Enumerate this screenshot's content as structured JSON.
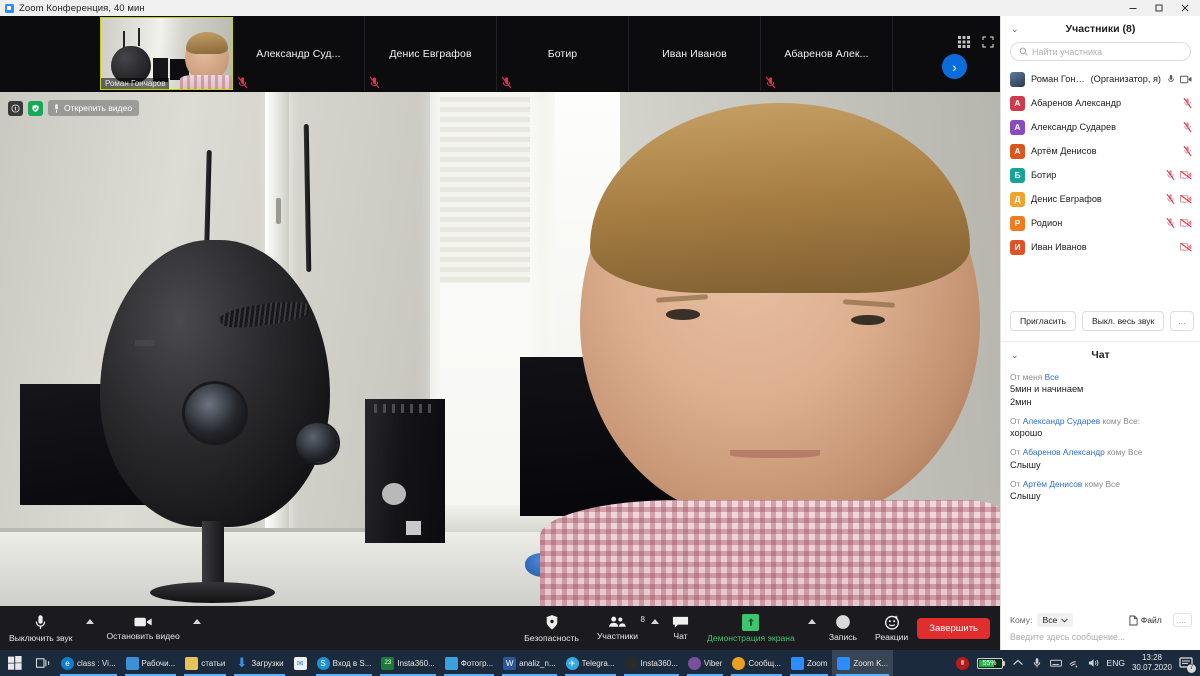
{
  "window": {
    "title": "Zoom Конференция, 40 мин",
    "app_icon": "zoom-icon",
    "minimize": "—",
    "maximize": "❐",
    "close": "✕"
  },
  "filmstrip": {
    "self": {
      "name": "Роман Гончаров"
    },
    "tiles": [
      {
        "name": "Александр  Суд...",
        "muted": true
      },
      {
        "name": "Денис Евграфов",
        "muted": true
      },
      {
        "name": "Ботир",
        "muted": true
      },
      {
        "name": "Иван Иванов",
        "muted": false
      },
      {
        "name": "Абаренов  Алек...",
        "muted": true
      }
    ],
    "next_arrow": "›",
    "grid_icon": "grid-view-icon",
    "fullscreen_icon": "fullscreen-icon"
  },
  "stage": {
    "pin_label": "Открепить видео",
    "speaker_name": "Роман Гончаров",
    "info_icon": "info-icon",
    "security_icon": "shield-icon",
    "mic_icon": "microphone-icon"
  },
  "toolbar": {
    "mute": "Выключить звук",
    "stop_video": "Остановить видео",
    "security": "Безопасность",
    "participants": "Участники",
    "participants_count": "8",
    "chat": "Чат",
    "share": "Демонстрация экрана",
    "record": "Запись",
    "reactions": "Реакции",
    "end": "Завершить"
  },
  "participants_panel": {
    "title": "Участники (8)",
    "collapse_icon": "chevron-down-icon",
    "search_placeholder": "Найти участника",
    "search_icon": "search-icon",
    "list": [
      {
        "name": "Роман Гончар...",
        "role": "(Организатор, я)",
        "initial": "",
        "color": "#3f5a78",
        "photo": true,
        "mic_muted": false,
        "cam_off": false
      },
      {
        "name": "Абаренов Александр",
        "role": "",
        "initial": "А",
        "color": "#cf3b4a",
        "photo": false,
        "mic_muted": true,
        "cam_off": false
      },
      {
        "name": "Александр Сударев",
        "role": "",
        "initial": "А",
        "color": "#8a4bbd",
        "photo": false,
        "mic_muted": true,
        "cam_off": false
      },
      {
        "name": "Артём Денисов",
        "role": "",
        "initial": "А",
        "color": "#d9571f",
        "photo": false,
        "mic_muted": true,
        "cam_off": false
      },
      {
        "name": "Ботир",
        "role": "",
        "initial": "Б",
        "color": "#17a398",
        "photo": false,
        "mic_muted": true,
        "cam_off": true
      },
      {
        "name": "Денис Евграфов",
        "role": "",
        "initial": "Д",
        "color": "#f0a32b",
        "photo": false,
        "mic_muted": true,
        "cam_off": true
      },
      {
        "name": "Родион",
        "role": "",
        "initial": "Р",
        "color": "#f07c1f",
        "photo": false,
        "mic_muted": true,
        "cam_off": true
      },
      {
        "name": "Иван Иванов",
        "role": "",
        "initial": "И",
        "color": "#e0522a",
        "photo": false,
        "mic_muted": false,
        "cam_off": true
      }
    ],
    "invite": "Пригласить",
    "mute_all": "Выкл. весь звук",
    "more": "..."
  },
  "chat_panel": {
    "title": "Чат",
    "collapse_icon": "chevron-down-icon",
    "messages": [
      {
        "prefix": "От меня",
        "who": "Все",
        "suffix": "",
        "lines": [
          "5мин и начинаем",
          "2мин"
        ]
      },
      {
        "prefix": "От",
        "who": "Александр Сударев",
        "suffix": "кому Все:",
        "lines": [
          "хорошо"
        ]
      },
      {
        "prefix": "От",
        "who": "Абаренов Александр",
        "suffix": "кому Все",
        "lines": [
          "Слышу"
        ]
      },
      {
        "prefix": "От",
        "who": "Артём Денисов",
        "suffix": "кому Все",
        "lines": [
          "Слышу"
        ]
      }
    ],
    "to_label": "Кому:",
    "to_value": "Все",
    "file_label": "Файл",
    "file_icon": "file-icon",
    "more": "...",
    "input_placeholder": "Введите здесь сообщение..."
  },
  "taskbar": {
    "start_icon": "windows-start-icon",
    "taskview_icon": "task-view-icon",
    "items": [
      {
        "label": "class : Vi...",
        "icon": "edge-icon",
        "color": "#0f7ec8",
        "glyph": "e",
        "active": false
      },
      {
        "label": "Рабочи...",
        "icon": "folder-blue-icon",
        "color": "#3d8fd6",
        "glyph": "",
        "active": false
      },
      {
        "label": "статьи",
        "icon": "folder-yellow-icon",
        "color": "#e8c15a",
        "glyph": "",
        "active": false
      },
      {
        "label": "Загрузки",
        "icon": "download-icon",
        "color": "#2f7fd6",
        "glyph": "↓",
        "active": false
      },
      {
        "label": "",
        "icon": "mail-icon",
        "color": "#f2f2f2",
        "glyph": "✉",
        "active": false
      },
      {
        "label": "Вход в S...",
        "icon": "skype-icon",
        "color": "#1e90d2",
        "glyph": "S",
        "active": false
      },
      {
        "label": "Insta360...",
        "icon": "insta360-icon",
        "color": "#1f7a3a",
        "glyph": "",
        "active": false
      },
      {
        "label": "Фотогр...",
        "icon": "photos-icon",
        "color": "#3aa0e0",
        "glyph": "",
        "active": false
      },
      {
        "label": "analiz_n...",
        "icon": "word-icon",
        "color": "#2b579a",
        "glyph": "W",
        "active": false
      },
      {
        "label": "Telegra...",
        "icon": "telegram-icon",
        "color": "#36a8e0",
        "glyph": "",
        "active": false
      },
      {
        "label": "Insta360...",
        "icon": "insta360-app-icon",
        "color": "#2a2a2a",
        "glyph": "",
        "active": false
      },
      {
        "label": "Viber",
        "icon": "viber-icon",
        "color": "#7b4fa0",
        "glyph": "",
        "active": false
      },
      {
        "label": "Сообщ...",
        "icon": "chrome-icon",
        "color": "#e8a020",
        "glyph": "",
        "active": false
      },
      {
        "label": "Zoom",
        "icon": "zoom-icon",
        "color": "#2d8cff",
        "glyph": "",
        "active": false
      },
      {
        "label": "Zoom K...",
        "icon": "zoom-icon",
        "color": "#2d8cff",
        "glyph": "",
        "active": true
      }
    ],
    "tray": {
      "record_icon": "record-red-icon",
      "battery_percent": "55%",
      "chevron_icon": "chevron-up-icon",
      "mic_icon": "microphone-icon",
      "keyboard_icon": "keyboard-icon",
      "network_icon": "wifi-icon",
      "volume_icon": "volume-icon",
      "language": "ENG",
      "time": "13:28",
      "date": "30.07.2020",
      "notifications_icon": "notifications-icon",
      "notifications_count": "7"
    }
  }
}
